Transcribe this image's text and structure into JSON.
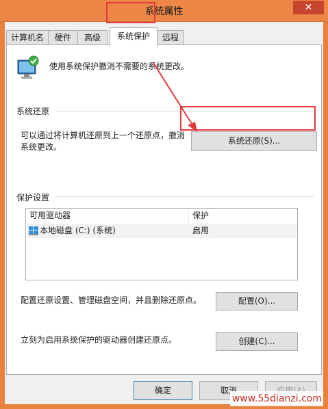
{
  "window": {
    "title": "系统属性",
    "close_glyph": "✕"
  },
  "tabs": [
    {
      "label": "计算机名"
    },
    {
      "label": "硬件"
    },
    {
      "label": "高级"
    },
    {
      "label": "系统保护"
    },
    {
      "label": "远程"
    }
  ],
  "panel": {
    "top_description": "使用系统保护撤消不需要的系统更改。",
    "restore_section": {
      "label": "系统还原",
      "description": "可以通过将计算机还原到上一个还原点，撤消系统更改。",
      "button_label": "系统还原(S)..."
    },
    "protection_section": {
      "label": "保护设置",
      "columns": [
        "可用驱动器",
        "保护"
      ],
      "rows": [
        {
          "drive": "本地磁盘 (C:) (系统)",
          "protection": "启用"
        }
      ]
    },
    "config": {
      "description": "配置还原设置、管理磁盘空间，并且删除还原点。",
      "button_label": "配置(O)..."
    },
    "create": {
      "description": "立刻为启用系统保护的驱动器创建还原点。",
      "button_label": "创建(C)..."
    }
  },
  "footer": {
    "ok_label": "确定",
    "cancel_label": "取消",
    "apply_label": "应用(A)"
  },
  "watermark": "www.55dianzi.com",
  "colors": {
    "titlebar": "#ec8748",
    "highlight": "#e5383a"
  }
}
